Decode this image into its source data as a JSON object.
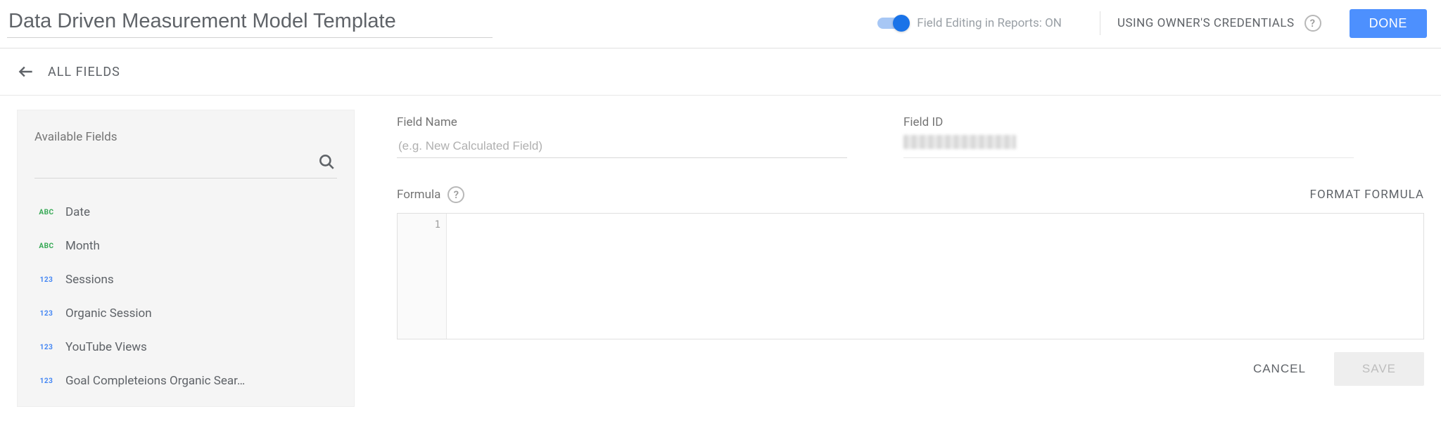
{
  "header": {
    "title": "Data Driven Measurement Model Template",
    "toggle_label": "Field Editing in Reports: ON",
    "credentials_label": "USING OWNER'S CREDENTIALS",
    "done_label": "DONE"
  },
  "subheader": {
    "all_fields_label": "ALL FIELDS"
  },
  "sidebar": {
    "title": "Available Fields",
    "search_placeholder": "",
    "fields": [
      {
        "type": "ABC",
        "label": "Date"
      },
      {
        "type": "ABC",
        "label": "Month"
      },
      {
        "type": "123",
        "label": "Sessions"
      },
      {
        "type": "123",
        "label": "Organic Session"
      },
      {
        "type": "123",
        "label": "YouTube Views"
      },
      {
        "type": "123",
        "label": "Goal Completeions Organic Sear…"
      }
    ]
  },
  "main": {
    "field_name_label": "Field Name",
    "field_name_placeholder": "(e.g. New Calculated Field)",
    "field_id_label": "Field ID",
    "formula_label": "Formula",
    "format_formula_label": "FORMAT FORMULA",
    "gutter_line": "1",
    "cancel_label": "CANCEL",
    "save_label": "SAVE"
  }
}
